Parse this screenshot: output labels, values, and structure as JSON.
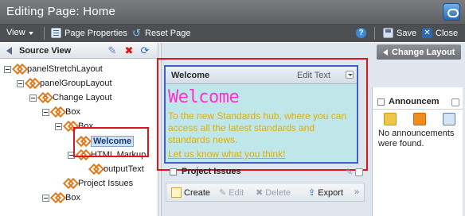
{
  "window": {
    "title": "Editing Page: Home"
  },
  "toolbar": {
    "view_label": "View",
    "page_properties_label": "Page Properties",
    "reset_page_label": "Reset Page",
    "save_label": "Save",
    "close_label": "Close"
  },
  "source_view": {
    "title": "Source View",
    "tree": [
      {
        "label": "panelStretchLayout",
        "level": 0
      },
      {
        "label": "panelGroupLayout",
        "level": 1
      },
      {
        "label": "Change Layout",
        "level": 2
      },
      {
        "label": "Box",
        "level": 3
      },
      {
        "label": "Box",
        "level": 4
      },
      {
        "label": "Welcome",
        "level": 5,
        "selected": true
      },
      {
        "label": "HTML Markup",
        "level": 5
      },
      {
        "label": "outputText",
        "level": 6
      },
      {
        "label": "Project Issues",
        "level": 4
      },
      {
        "label": "Box",
        "level": 3
      }
    ]
  },
  "canvas": {
    "change_layout_label": "Change Layout",
    "welcome": {
      "header": "Welcome",
      "edit_text": "Edit Text",
      "heading": "Welcome",
      "body": "To the new Standards hub, where you can access all the latest standards and standards news.",
      "link": "Let us know what you think!"
    },
    "project_issues": {
      "title": "Project Issues",
      "create": "Create",
      "edit": "Edit",
      "delete": "Delete",
      "export": "Export"
    },
    "announcements": {
      "title": "Announcem",
      "empty": "No announcements were found."
    }
  },
  "colors": {
    "heading": "#ff2fd0",
    "body_text": "#e0b000",
    "highlight": "#e0141c",
    "selection": "#3e5fc7"
  }
}
